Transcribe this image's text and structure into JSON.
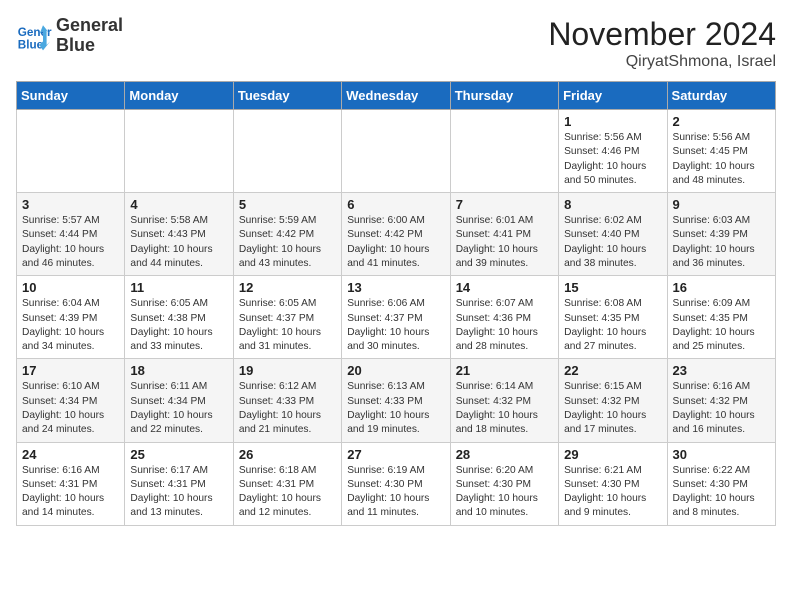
{
  "header": {
    "logo_line1": "General",
    "logo_line2": "Blue",
    "month_title": "November 2024",
    "location": "QiryatShmona, Israel"
  },
  "days_of_week": [
    "Sunday",
    "Monday",
    "Tuesday",
    "Wednesday",
    "Thursday",
    "Friday",
    "Saturday"
  ],
  "weeks": [
    [
      {
        "day": "",
        "info": ""
      },
      {
        "day": "",
        "info": ""
      },
      {
        "day": "",
        "info": ""
      },
      {
        "day": "",
        "info": ""
      },
      {
        "day": "",
        "info": ""
      },
      {
        "day": "1",
        "info": "Sunrise: 5:56 AM\nSunset: 4:46 PM\nDaylight: 10 hours and 50 minutes."
      },
      {
        "day": "2",
        "info": "Sunrise: 5:56 AM\nSunset: 4:45 PM\nDaylight: 10 hours and 48 minutes."
      }
    ],
    [
      {
        "day": "3",
        "info": "Sunrise: 5:57 AM\nSunset: 4:44 PM\nDaylight: 10 hours and 46 minutes."
      },
      {
        "day": "4",
        "info": "Sunrise: 5:58 AM\nSunset: 4:43 PM\nDaylight: 10 hours and 44 minutes."
      },
      {
        "day": "5",
        "info": "Sunrise: 5:59 AM\nSunset: 4:42 PM\nDaylight: 10 hours and 43 minutes."
      },
      {
        "day": "6",
        "info": "Sunrise: 6:00 AM\nSunset: 4:42 PM\nDaylight: 10 hours and 41 minutes."
      },
      {
        "day": "7",
        "info": "Sunrise: 6:01 AM\nSunset: 4:41 PM\nDaylight: 10 hours and 39 minutes."
      },
      {
        "day": "8",
        "info": "Sunrise: 6:02 AM\nSunset: 4:40 PM\nDaylight: 10 hours and 38 minutes."
      },
      {
        "day": "9",
        "info": "Sunrise: 6:03 AM\nSunset: 4:39 PM\nDaylight: 10 hours and 36 minutes."
      }
    ],
    [
      {
        "day": "10",
        "info": "Sunrise: 6:04 AM\nSunset: 4:39 PM\nDaylight: 10 hours and 34 minutes."
      },
      {
        "day": "11",
        "info": "Sunrise: 6:05 AM\nSunset: 4:38 PM\nDaylight: 10 hours and 33 minutes."
      },
      {
        "day": "12",
        "info": "Sunrise: 6:05 AM\nSunset: 4:37 PM\nDaylight: 10 hours and 31 minutes."
      },
      {
        "day": "13",
        "info": "Sunrise: 6:06 AM\nSunset: 4:37 PM\nDaylight: 10 hours and 30 minutes."
      },
      {
        "day": "14",
        "info": "Sunrise: 6:07 AM\nSunset: 4:36 PM\nDaylight: 10 hours and 28 minutes."
      },
      {
        "day": "15",
        "info": "Sunrise: 6:08 AM\nSunset: 4:35 PM\nDaylight: 10 hours and 27 minutes."
      },
      {
        "day": "16",
        "info": "Sunrise: 6:09 AM\nSunset: 4:35 PM\nDaylight: 10 hours and 25 minutes."
      }
    ],
    [
      {
        "day": "17",
        "info": "Sunrise: 6:10 AM\nSunset: 4:34 PM\nDaylight: 10 hours and 24 minutes."
      },
      {
        "day": "18",
        "info": "Sunrise: 6:11 AM\nSunset: 4:34 PM\nDaylight: 10 hours and 22 minutes."
      },
      {
        "day": "19",
        "info": "Sunrise: 6:12 AM\nSunset: 4:33 PM\nDaylight: 10 hours and 21 minutes."
      },
      {
        "day": "20",
        "info": "Sunrise: 6:13 AM\nSunset: 4:33 PM\nDaylight: 10 hours and 19 minutes."
      },
      {
        "day": "21",
        "info": "Sunrise: 6:14 AM\nSunset: 4:32 PM\nDaylight: 10 hours and 18 minutes."
      },
      {
        "day": "22",
        "info": "Sunrise: 6:15 AM\nSunset: 4:32 PM\nDaylight: 10 hours and 17 minutes."
      },
      {
        "day": "23",
        "info": "Sunrise: 6:16 AM\nSunset: 4:32 PM\nDaylight: 10 hours and 16 minutes."
      }
    ],
    [
      {
        "day": "24",
        "info": "Sunrise: 6:16 AM\nSunset: 4:31 PM\nDaylight: 10 hours and 14 minutes."
      },
      {
        "day": "25",
        "info": "Sunrise: 6:17 AM\nSunset: 4:31 PM\nDaylight: 10 hours and 13 minutes."
      },
      {
        "day": "26",
        "info": "Sunrise: 6:18 AM\nSunset: 4:31 PM\nDaylight: 10 hours and 12 minutes."
      },
      {
        "day": "27",
        "info": "Sunrise: 6:19 AM\nSunset: 4:30 PM\nDaylight: 10 hours and 11 minutes."
      },
      {
        "day": "28",
        "info": "Sunrise: 6:20 AM\nSunset: 4:30 PM\nDaylight: 10 hours and 10 minutes."
      },
      {
        "day": "29",
        "info": "Sunrise: 6:21 AM\nSunset: 4:30 PM\nDaylight: 10 hours and 9 minutes."
      },
      {
        "day": "30",
        "info": "Sunrise: 6:22 AM\nSunset: 4:30 PM\nDaylight: 10 hours and 8 minutes."
      }
    ]
  ]
}
